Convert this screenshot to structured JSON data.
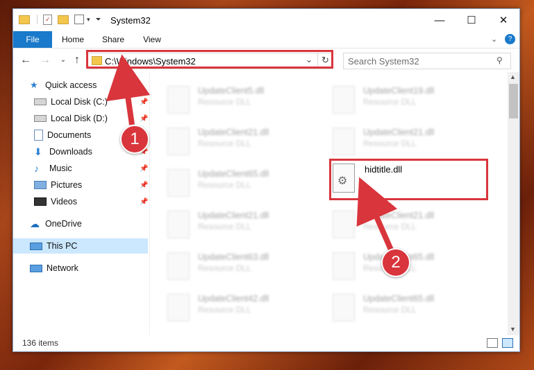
{
  "window": {
    "title": "System32",
    "min": "—",
    "max": "☐",
    "close": "✕"
  },
  "ribbon": {
    "tabs": [
      "File",
      "Home",
      "Share",
      "View"
    ]
  },
  "address": {
    "path": "C:\\Windows\\System32",
    "search_placeholder": "Search System32"
  },
  "sidebar": {
    "items": [
      {
        "label": "Quick access",
        "icon": "star-icon"
      },
      {
        "label": "Local Disk (C:)",
        "icon": "drive-icon"
      },
      {
        "label": "Local Disk (D:)",
        "icon": "drive-icon"
      },
      {
        "label": "Documents",
        "icon": "documents-icon"
      },
      {
        "label": "Downloads",
        "icon": "download-icon"
      },
      {
        "label": "Music",
        "icon": "music-icon"
      },
      {
        "label": "Pictures",
        "icon": "pictures-icon"
      },
      {
        "label": "Videos",
        "icon": "videos-icon"
      },
      {
        "label": "OneDrive",
        "icon": "cloud-icon"
      },
      {
        "label": "This PC",
        "icon": "computer-icon"
      },
      {
        "label": "Network",
        "icon": "network-icon"
      }
    ]
  },
  "files": [
    {
      "name": "UpdateClient5.dll",
      "desc": "Resource DLL"
    },
    {
      "name": "UpdateClient19.dll",
      "desc": "Resource DLL"
    },
    {
      "name": "UpdateClient21.dll",
      "desc": "Resource DLL"
    },
    {
      "name": "UpdateClient21.dll",
      "desc": "Resource DLL"
    },
    {
      "name": "UpdateClient65.dll",
      "desc": "Resource DLL"
    },
    {
      "name": "UpdateClient21.dll",
      "desc": "Resource DLL"
    },
    {
      "name": "UpdateClient21.dll",
      "desc": "Resource DLL"
    },
    {
      "name": "UpdateClient63.dll",
      "desc": "Resource DLL"
    },
    {
      "name": "UpdateClient65.dll",
      "desc": "Resource DLL"
    },
    {
      "name": "UpdateClient42.dll",
      "desc": "Resource DLL"
    },
    {
      "name": "UpdateClient65.dll",
      "desc": "Resource DLL"
    }
  ],
  "highlight_file": {
    "name": "hidtitle.dll"
  },
  "status": {
    "items_count": "136 items"
  },
  "annotations": {
    "step1": "1",
    "step2": "2",
    "color": "#d9353c"
  }
}
